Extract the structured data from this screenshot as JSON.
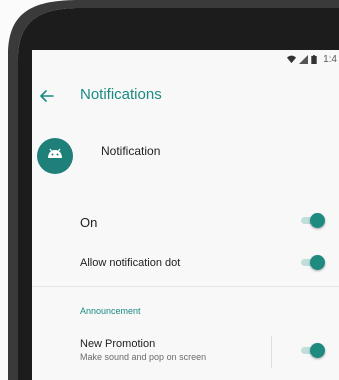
{
  "status_bar": {
    "time": "1:4",
    "icons": [
      "wifi-icon",
      "signal-icon",
      "battery-icon"
    ]
  },
  "app_bar": {
    "back_icon": "arrow-left-icon",
    "title": "Notifications"
  },
  "app_header": {
    "icon": "android-icon",
    "name": "Notification"
  },
  "settings": {
    "on": {
      "label": "On",
      "checked": true
    },
    "allow_dot": {
      "label": "Allow notification dot",
      "checked": true
    }
  },
  "announcement": {
    "header": "Announcement",
    "new_promotion": {
      "label": "New Promotion",
      "summary": "Make sound and pop on screen",
      "checked": true
    }
  },
  "colors": {
    "accent": "#1b8a82",
    "toggle_thumb": "#1e8a80",
    "avatar_bg": "#1f7f79",
    "phone_frame": "#1c1c1c"
  }
}
